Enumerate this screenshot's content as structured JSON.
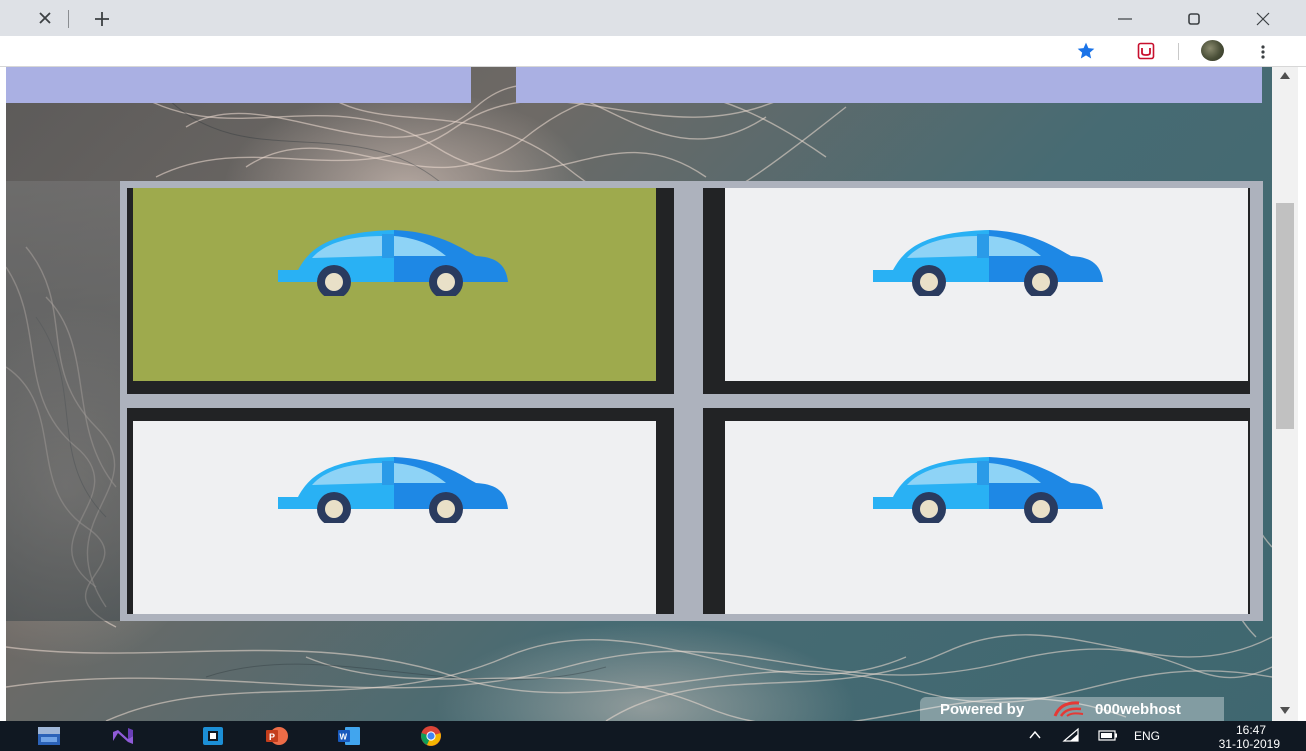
{
  "browser": {
    "icons": [
      "close-icon",
      "new-tab-icon",
      "minimize-icon",
      "maximize-icon",
      "window-close-icon",
      "bookmark-star-icon",
      "extension-icon",
      "profile-avatar",
      "menu-icon"
    ],
    "accent_color": "#1a73e8"
  },
  "page": {
    "navbar_color": "#aab0e3",
    "board": {
      "cards": [
        {
          "state": "matched",
          "icon": "car-icon",
          "face_color": "#9eaa4d"
        },
        {
          "state": "revealed",
          "icon": "car-icon",
          "face_color": "#eff0f2"
        },
        {
          "state": "revealed",
          "icon": "car-icon",
          "face_color": "#eff0f2"
        },
        {
          "state": "revealed",
          "icon": "car-icon",
          "face_color": "#eff0f2"
        }
      ]
    },
    "powered_by": {
      "label": "Powered by",
      "brand": "000webhost"
    }
  },
  "taskbar": {
    "apps": [
      "devc-icon",
      "visual-studio-icon",
      "codeblocks-icon",
      "powerpoint-icon",
      "word-icon",
      "chrome-icon"
    ],
    "language": "ENG",
    "time": "16:47",
    "date": "31-10-2019"
  }
}
